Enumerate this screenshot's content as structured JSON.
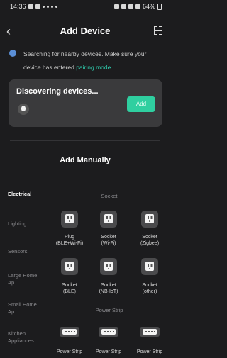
{
  "status_bar": {
    "time": "14:36",
    "battery": "64%"
  },
  "header": {
    "title": "Add Device"
  },
  "notice": {
    "text": "Searching for nearby devices. Make sure your device has entered ",
    "link": "pairing mode",
    "end": "."
  },
  "discovering": {
    "title": "Discovering devices...",
    "add_label": "Add"
  },
  "add_manually": "Add Manually",
  "categories": [
    {
      "label": "Electrical",
      "active": true
    },
    {
      "label": "Lighting"
    },
    {
      "label": "Sensors"
    },
    {
      "label": "Large Home Ap..."
    },
    {
      "label": "Small Home Ap..."
    },
    {
      "label": "Kitchen Appliances"
    }
  ],
  "sections": [
    {
      "title": "Socket",
      "devices": [
        {
          "name": "Plug",
          "sub": "(BLE+Wi-Fi)"
        },
        {
          "name": "Socket",
          "sub": "(Wi-Fi)"
        },
        {
          "name": "Socket",
          "sub": "(Zigbee)"
        },
        {
          "name": "Socket",
          "sub": "(BLE)"
        },
        {
          "name": "Socket",
          "sub": "(NB-IoT)"
        },
        {
          "name": "Socket",
          "sub": "(other)"
        }
      ]
    },
    {
      "title": "Power Strip",
      "devices": [
        {
          "name": "Power Strip"
        },
        {
          "name": "Power Strip"
        },
        {
          "name": "Power Strip"
        }
      ]
    }
  ]
}
